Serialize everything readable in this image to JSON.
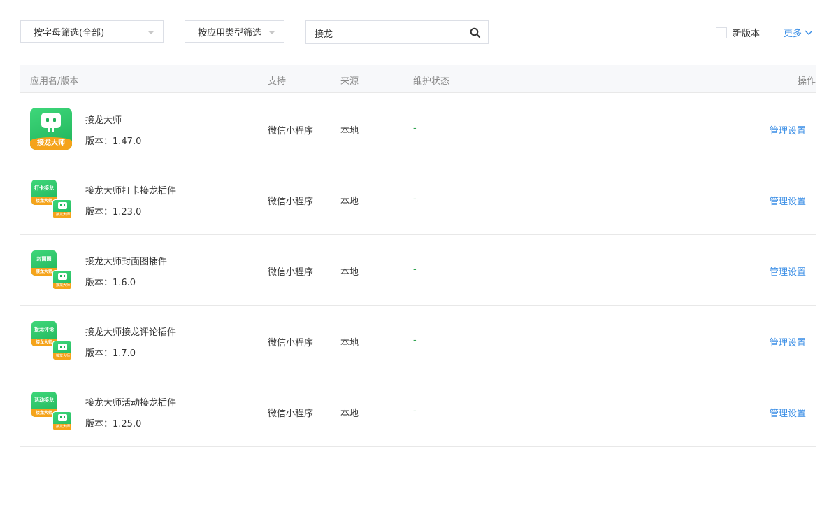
{
  "toolbar": {
    "letter_filter": "按字母筛选(全部)",
    "type_filter": "按应用类型筛选",
    "search_value": "接龙",
    "search_placeholder": "接龙",
    "new_version_label": "新版本",
    "more_label": "更多"
  },
  "table": {
    "headers": {
      "name": "应用名/版本",
      "support": "支持",
      "source": "来源",
      "status": "维护状态",
      "action": "操作"
    },
    "version_prefix": "版本：",
    "rows": [
      {
        "name": "接龙大师",
        "version": "版本：1.47.0",
        "support": "微信小程序",
        "source": "本地",
        "status": "-",
        "action": "管理设置",
        "icon": {
          "kind": "main",
          "band": "接龙大师"
        }
      },
      {
        "name": "接龙大师打卡接龙插件",
        "version": "版本：1.23.0",
        "support": "微信小程序",
        "source": "本地",
        "status": "-",
        "action": "管理设置",
        "icon": {
          "kind": "plugin",
          "title": "打卡接龙",
          "band": "接龙大师",
          "small_band": "接龙大师"
        }
      },
      {
        "name": "接龙大师封面图插件",
        "version": "版本：1.6.0",
        "support": "微信小程序",
        "source": "本地",
        "status": "-",
        "action": "管理设置",
        "icon": {
          "kind": "plugin",
          "title": "封面图",
          "band": "接龙大师",
          "small_band": "接龙大师"
        }
      },
      {
        "name": "接龙大师接龙评论插件",
        "version": "版本：1.7.0",
        "support": "微信小程序",
        "source": "本地",
        "status": "-",
        "action": "管理设置",
        "icon": {
          "kind": "plugin",
          "title": "接龙评论",
          "band": "接龙大师",
          "small_band": "接龙大师"
        }
      },
      {
        "name": "接龙大师活动接龙插件",
        "version": "版本：1.25.0",
        "support": "微信小程序",
        "source": "本地",
        "status": "-",
        "action": "管理设置",
        "icon": {
          "kind": "plugin",
          "title": "活动接龙",
          "band": "接龙大师",
          "small_band": "接龙大师"
        }
      }
    ]
  },
  "colors": {
    "link": "#3a8ee6",
    "status_ok": "#2ea44f",
    "icon_green": "#20b35a",
    "icon_orange": "#f5a31a",
    "header_bg": "#f7f8fa"
  }
}
